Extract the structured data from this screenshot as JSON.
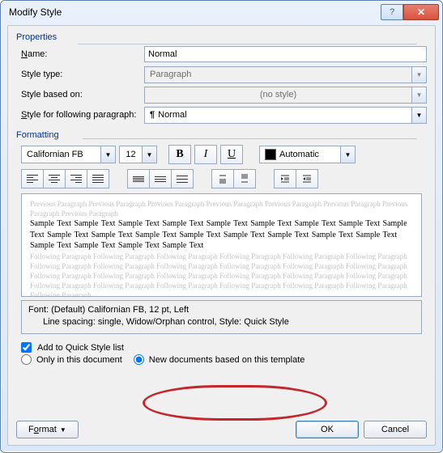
{
  "title": "Modify Style",
  "properties": {
    "heading": "Properties",
    "name_label": "Name:",
    "name_value": "Normal",
    "style_type_label": "Style type:",
    "style_type_value": "Paragraph",
    "based_on_label": "Style based on:",
    "based_on_value": "(no style)",
    "following_label": "Style for following paragraph:",
    "following_value": "Normal"
  },
  "formatting": {
    "heading": "Formatting",
    "font_name": "Californian FB",
    "font_size": "12",
    "bold": "B",
    "italic": "I",
    "underline": "U",
    "color_label": "Automatic"
  },
  "preview": {
    "ghost_prev": "Previous Paragraph Previous Paragraph Previous Paragraph Previous Paragraph Previous Paragraph Previous Paragraph Previous Paragraph Previous Paragraph",
    "sample": "Sample Text Sample Text Sample Text Sample Text Sample Text Sample Text Sample Text Sample Text Sample Text Sample Text Sample Text Sample Text Sample Text Sample Text Sample Text Sample Text Sample Text Sample Text Sample Text Sample Text Sample Text",
    "ghost_next": "Following Paragraph Following Paragraph Following Paragraph Following Paragraph Following Paragraph Following Paragraph Following Paragraph Following Paragraph Following Paragraph Following Paragraph Following Paragraph Following Paragraph Following Paragraph Following Paragraph Following Paragraph Following Paragraph Following Paragraph Following Paragraph Following Paragraph Following Paragraph Following Paragraph Following Paragraph Following Paragraph Following Paragraph Following Paragraph"
  },
  "description": {
    "line1": "Font: (Default) Californian FB, 12 pt, Left",
    "line2": "Line spacing:  single, Widow/Orphan control, Style: Quick Style"
  },
  "options": {
    "add_quick": "Add to Quick Style list",
    "only_doc": "Only in this document",
    "new_docs": "New documents based on this template"
  },
  "footer": {
    "format": "Format",
    "ok": "OK",
    "cancel": "Cancel"
  }
}
